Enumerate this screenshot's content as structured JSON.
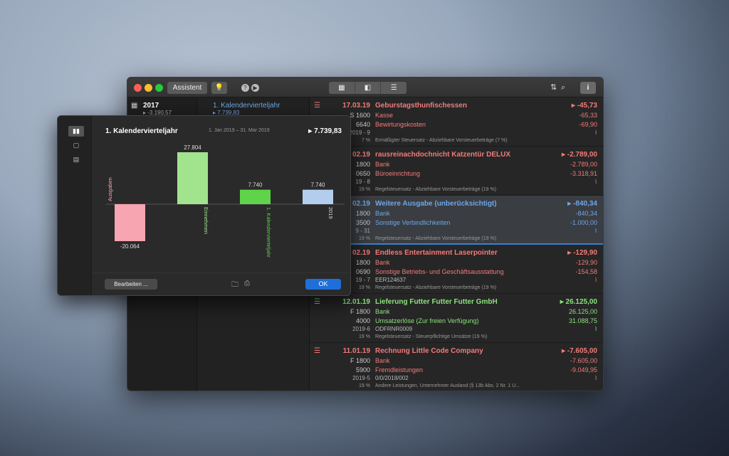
{
  "toolbar": {
    "assistent_label": "Assistent",
    "bulb_icon": "lightbulb-icon",
    "help_label": "?",
    "play_label": "▶",
    "view_icons": [
      "calendar-view-icon",
      "sidebar-view-icon",
      "list-view-icon"
    ],
    "sort_label": "⇅",
    "search_label": "⌕",
    "info_label": "i"
  },
  "sidebar": {
    "year": {
      "label": "2017",
      "value": "▸ -3.190,57"
    }
  },
  "quarters": {
    "selected": {
      "label": "1. Kalendervierteljahr",
      "value": "▸ 7.739,83"
    }
  },
  "transactions": [
    {
      "date": "17.03.19",
      "account": "S 1600",
      "counter": "6640",
      "ref": "2019 - 9",
      "tax_rate": "7 %",
      "title": "Geburstagsthunfischessen",
      "sub1": "Kasse",
      "sub2": "Bewirtungskosten",
      "note": "Ermäßigter Steuersatz - Abziehbare Vorsteuerbeträge (7 %)",
      "amount": "▸ -45,73",
      "amt1": "-65,33",
      "amt2": "-69,90",
      "color": "red",
      "selected": false
    },
    {
      "date": "02.19",
      "account": "1800",
      "counter": "0650",
      "ref": "19 - 8",
      "tax_rate": "19 %",
      "title": "rausreinachdochnicht Katzentür DELUX",
      "sub1": "Bank",
      "sub2": "Büroeinrichtung",
      "note": "Regelsteuersatz - Abziehbare Vorsteuerbeträge (19 %)",
      "amount": "▸ -2.789,00",
      "amt1": "-2.789,00",
      "amt2": "-3.318,91",
      "color": "red",
      "selected": false
    },
    {
      "date": "02.19",
      "account": "1800",
      "counter": "3500",
      "ref": "9 - 31",
      "tax_rate": "19 %",
      "title": "Weitere Ausgabe (unberücksichtigt)",
      "sub1": "Bank",
      "sub2": "Sonstige Verbindlichkeiten",
      "note": "Regelsteuersatz - Abziehbare Vorsteuerbeträge (19 %)",
      "amount": "▸ -840,34",
      "amt1": "-840,34",
      "amt2": "-1.000,00",
      "color": "blue",
      "selected": true
    },
    {
      "date": "02.19",
      "account": "1800",
      "counter": "0690",
      "ref": "19 - 7",
      "tax_rate": "19 %",
      "title": "Endless Entertainment Laserpointer",
      "sub1": "Bank",
      "sub2": "Sonstige Betriebs- und Geschäftsausstattung",
      "sub3": "EER124637",
      "note": "Regelsteuersatz - Abziehbare Vorsteuerbeträge (19 %)",
      "amount": "▸ -129,90",
      "amt1": "-129,90",
      "amt2": "-154,58",
      "color": "red",
      "selected": false
    },
    {
      "date": "12.01.19",
      "account": "F 1800",
      "counter": "4000",
      "ref": "2019-6",
      "tax_rate": "19 %",
      "title": "Lieferung Futter Futter Futter GmbH",
      "sub1": "Bank",
      "sub2": "Umsatzerlöse (Zur freien Verfügung)",
      "sub3": "ODFRNR0009",
      "note": "Regelsteuersatz - Steuerpflichtige Umsätze (19 %)",
      "amount": "▸ 26.125,00",
      "amt1": "26.125,00",
      "amt2": "31.088,75",
      "color": "green",
      "selected": false
    },
    {
      "date": "11.01.19",
      "account": "F 1800",
      "counter": "5900",
      "ref": "2019-5",
      "tax_rate": "19 %",
      "title": "Rechnung Little Code Company",
      "sub1": "Bank",
      "sub2": "Fremdleistungen",
      "sub3": "0/0/2018/002",
      "note": "Andere Leistungen, Unternehmer Ausland (§ 13b Abs. 2 Nr. 1 U...",
      "amount": "▸ -7.605,00",
      "amt1": "-7.605,00",
      "amt2": "-9.049,95",
      "color": "red",
      "selected": false
    }
  ],
  "popup": {
    "title": "1. Kalendervierteljahr",
    "range": "1. Jan 2019 – 31. Mar 2019",
    "total": "▸ 7.739,83",
    "edit_label": "Bearbeiten ...",
    "ok_label": "OK"
  },
  "chart_data": {
    "type": "bar",
    "categories": [
      "Ausgaben",
      "Einnehmen",
      "1. Kalendervierteljahr",
      "2019"
    ],
    "values": [
      -20064,
      27804,
      7740,
      7740
    ],
    "labels": [
      "-20.064",
      "27.804",
      "7.740",
      "7.740"
    ],
    "colors": [
      "#f7a5b0",
      "#a2e38d",
      "#5fd44a",
      "#b3cdee"
    ],
    "label_colors": [
      "#f7a5b0",
      "#a2e38d",
      "#5fd44a",
      "#dddddd"
    ],
    "title": "",
    "ylim": [
      -20064,
      27804
    ]
  }
}
